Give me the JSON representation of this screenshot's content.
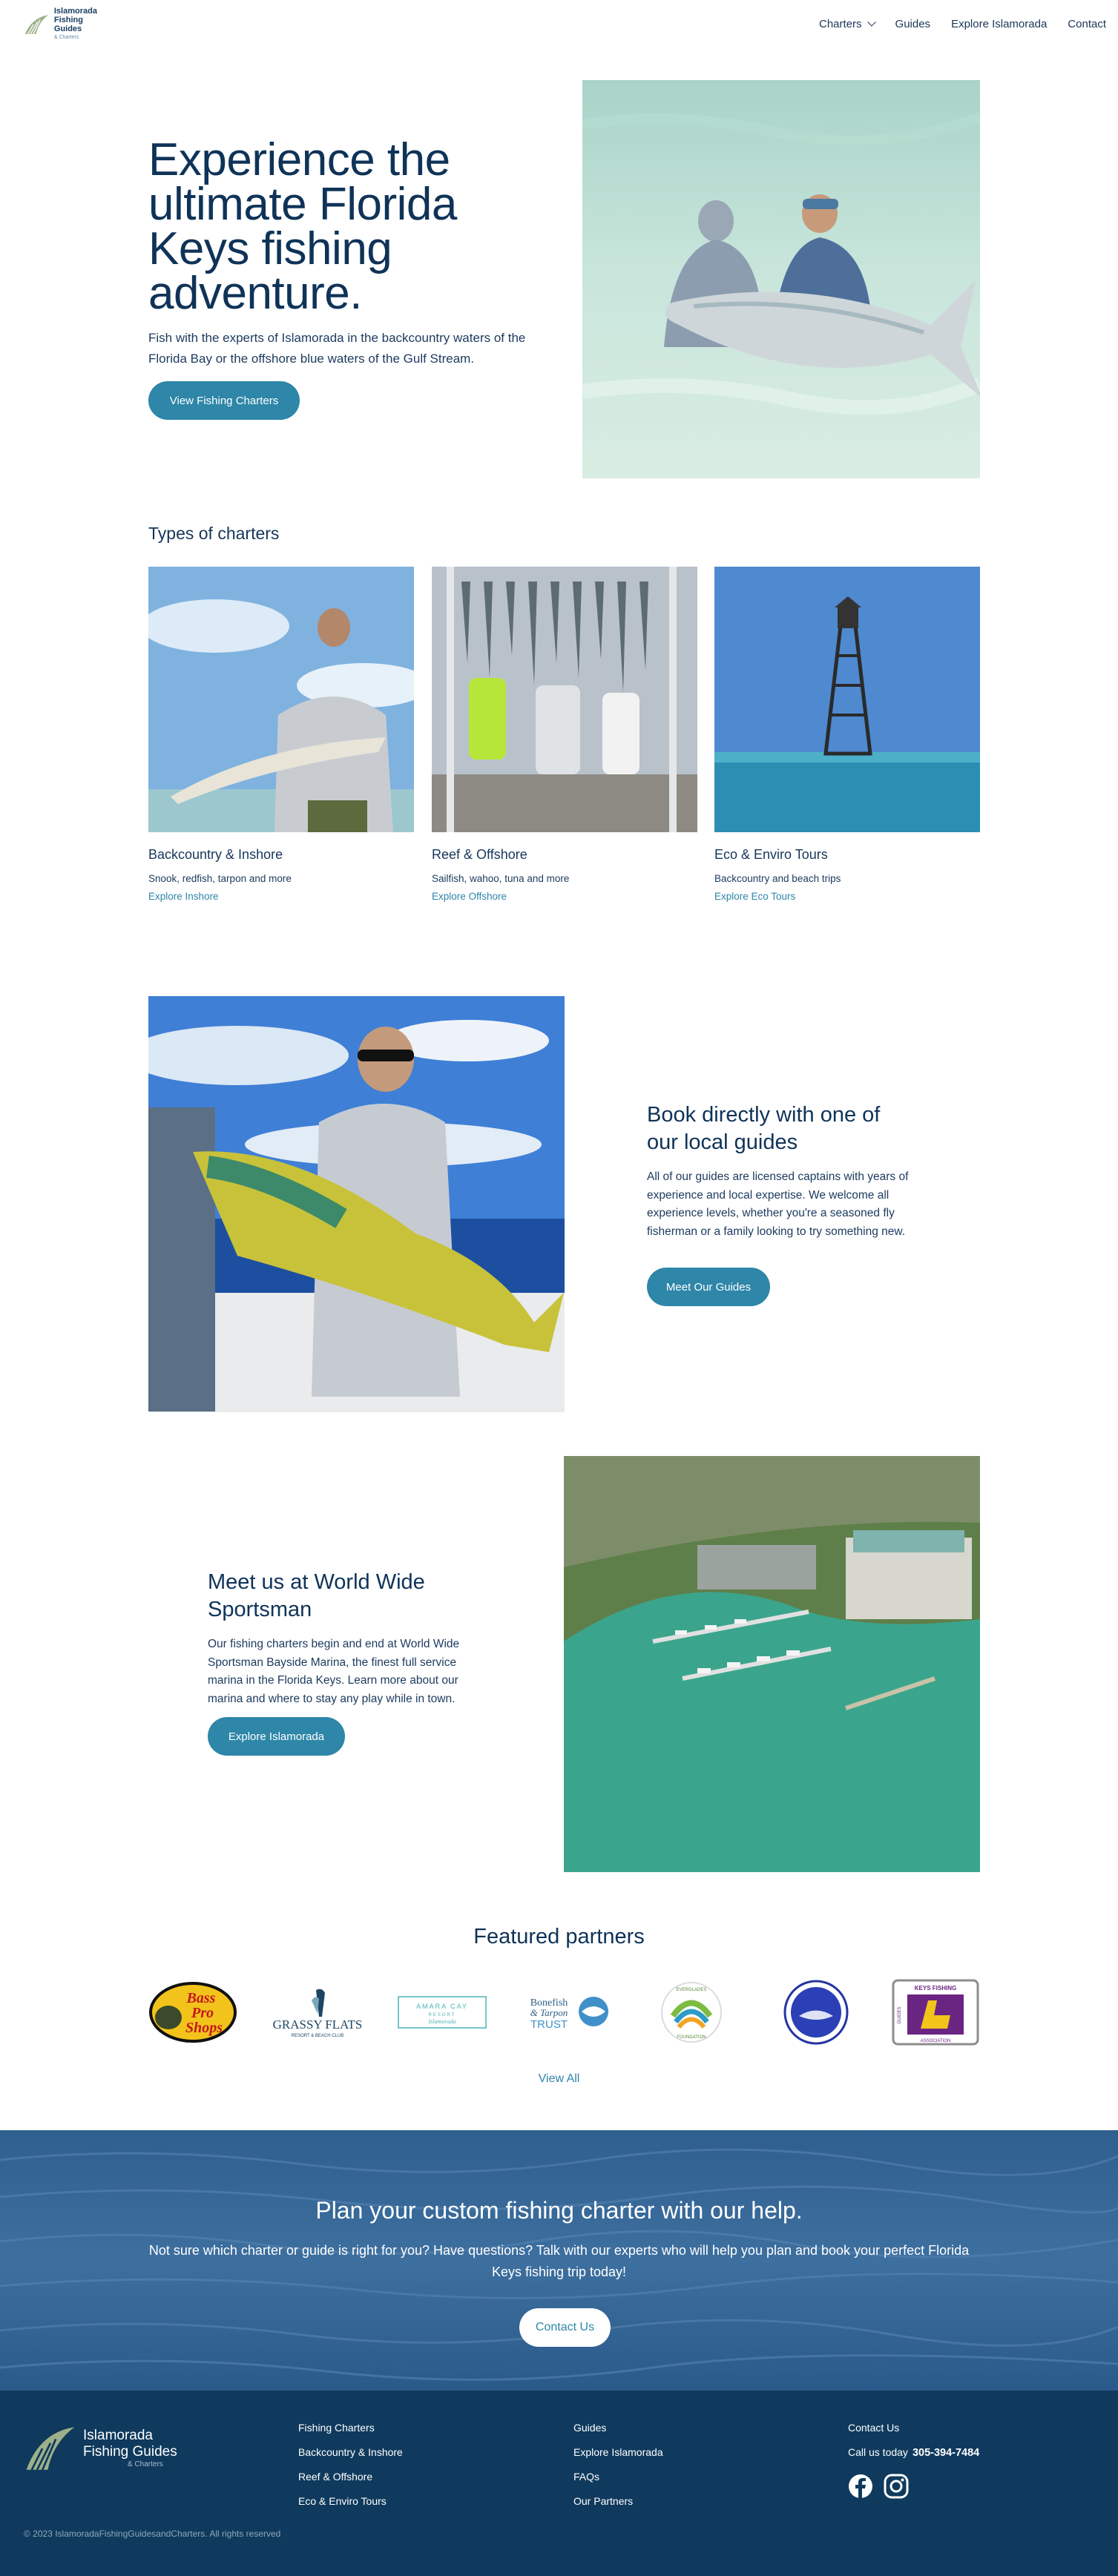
{
  "nav": {
    "logo": {
      "line1": "Islamorada",
      "line2": "Fishing Guides",
      "line3": "& Charters"
    },
    "links": [
      "Charters",
      "Guides",
      "Explore Islamorada",
      "Contact"
    ]
  },
  "hero": {
    "title": "Experience the ultimate Florida Keys fishing adventure.",
    "text": "Fish with the experts of Islamorada in the backcountry waters of the Florida Bay or the offshore blue waters of the Gulf Stream.",
    "button": "View Fishing Charters"
  },
  "types": {
    "heading": "Types of charters",
    "cards": [
      {
        "title": "Backcountry & Inshore",
        "desc": "Snook, redfish, tarpon and more",
        "link": "Explore Inshore"
      },
      {
        "title": "Reef & Offshore",
        "desc": "Sailfish, wahoo, tuna and more",
        "link": "Explore Offshore"
      },
      {
        "title": "Eco & Enviro Tours",
        "desc": "Backcountry and beach trips",
        "link": "Explore Eco Tours"
      }
    ]
  },
  "book": {
    "title": "Book directly with one of our local guides",
    "text": "All of our guides are licensed captains with years of experience and local expertise. We welcome all experience levels, whether you're a seasoned fly fisherman or a family looking to try something new.",
    "button": "Meet Our Guides"
  },
  "sportsman": {
    "title": "Meet us at World Wide Sportsman",
    "text": "Our fishing charters begin and end at World Wide Sportsman Bayside Marina, the finest full service marina in the Florida Keys. Learn more about our marina and where to stay any play while in town.",
    "button": "Explore Islamorada"
  },
  "partners": {
    "heading": "Featured partners",
    "logos": {
      "bass": {
        "line1": "Bass",
        "line2": "Pro",
        "line3": "Shops"
      },
      "grassy": {
        "line1": "GRASSY FLATS",
        "line2": "RESORT & BEACH CLUB"
      },
      "amara": {
        "line1": "AMARA CAY",
        "line2": "RESORT",
        "line3": "Islamorada"
      },
      "bonefish": {
        "line1": "Bonefish",
        "line2": "& Tarpon",
        "line3": "TRUST"
      },
      "everglades": {
        "line1": "EVERGLADES",
        "line2": "FOUNDATION"
      },
      "keys": {
        "line1": "KEYS FISHING",
        "line2": "GUIDES",
        "line3": "ASSOCIATION"
      }
    },
    "view_all": "View All"
  },
  "cta": {
    "title": "Plan your custom fishing charter with our help.",
    "text": "Not sure which charter or guide is right for you? Have questions? Talk with our experts who will help you plan and book your perfect Florida Keys fishing trip today!",
    "button": "Contact Us"
  },
  "footer": {
    "logo": {
      "line1": "Islamorada",
      "line2": "Fishing Guides",
      "line3": "& Charters"
    },
    "col1": [
      "Fishing Charters",
      "Backcountry & Inshore",
      "Reef & Offshore",
      "Eco & Enviro Tours"
    ],
    "col2": [
      "Guides",
      "Explore Islamorada",
      "FAQs",
      "Our Partners"
    ],
    "contact_label": "Contact Us",
    "call_label": "Call us today",
    "phone": "305-394-7484",
    "copyright": "© 2023 IslamoradaFishingGuidesandCharters. All rights reserved"
  },
  "colors": {
    "accent": "#2e86a8",
    "navy": "#0f3a5d",
    "heading": "#0f3358"
  }
}
